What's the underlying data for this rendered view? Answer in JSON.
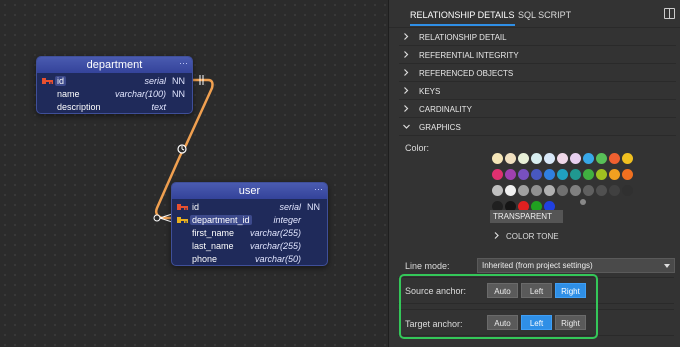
{
  "diagram": {
    "department": {
      "title": "department",
      "menu": "···",
      "columns": [
        {
          "name": "id",
          "type": "serial",
          "nn": "NN",
          "key": "pk"
        },
        {
          "name": "name",
          "type": "varchar(100)",
          "nn": "NN",
          "key": ""
        },
        {
          "name": "description",
          "type": "text",
          "nn": "",
          "key": ""
        }
      ]
    },
    "user": {
      "title": "user",
      "menu": "···",
      "columns": [
        {
          "name": "id",
          "type": "serial",
          "nn": "NN",
          "key": "pk"
        },
        {
          "name": "department_id",
          "type": "integer",
          "nn": "",
          "key": "fk"
        },
        {
          "name": "first_name",
          "type": "varchar(255)",
          "nn": "",
          "key": ""
        },
        {
          "name": "last_name",
          "type": "varchar(255)",
          "nn": "",
          "key": ""
        },
        {
          "name": "phone",
          "type": "varchar(50)",
          "nn": "",
          "key": ""
        }
      ]
    },
    "relationship_color": "#f0a050"
  },
  "panel": {
    "tabs": [
      "RELATIONSHIP DETAILS",
      "SQL SCRIPT"
    ],
    "sections": [
      "RELATIONSHIP DETAIL",
      "REFERENTIAL INTEGRITY",
      "REFERENCED OBJECTS",
      "KEYS",
      "CARDINALITY",
      "GRAPHICS"
    ],
    "color_label": "Color:",
    "palette": [
      [
        "#f5e6b8",
        "#f0e0c0",
        "#e8f0d8",
        "#d8eef0",
        "#d8e8f8",
        "#f0d8e8",
        "#e8d0f0",
        "#38a8e8",
        "#58c058",
        "#f06030",
        "#f0c020"
      ],
      [
        "#e03070",
        "#a040b0",
        "#7850c0",
        "#4858c0",
        "#3080e0",
        "#20a0c0",
        "#209890",
        "#40b040",
        "#a0c020",
        "#f0a020",
        "#f07020"
      ],
      [
        "#c0c0c0",
        "#f0f0f0",
        "#a0a0a0",
        "#909090",
        "#b0b0b0",
        "#707070",
        "#808080",
        "#606060",
        "#505050",
        "#404040",
        "#303030"
      ],
      [
        "#202020",
        "#151515",
        "#e02020",
        "#20a020",
        "#2040e0",
        "#888888"
      ]
    ],
    "transparent_label": "TRANSPARENT",
    "color_tone_label": "COLOR TONE",
    "line_mode_label": "Line mode:",
    "line_mode_value": "Inherited (from project settings)",
    "source_anchor_label": "Source anchor:",
    "target_anchor_label": "Target anchor:",
    "anchor_options": [
      "Auto",
      "Left",
      "Right"
    ],
    "source_anchor_selected": "Right",
    "target_anchor_selected": "Left",
    "highlight_color": "#34c759"
  }
}
